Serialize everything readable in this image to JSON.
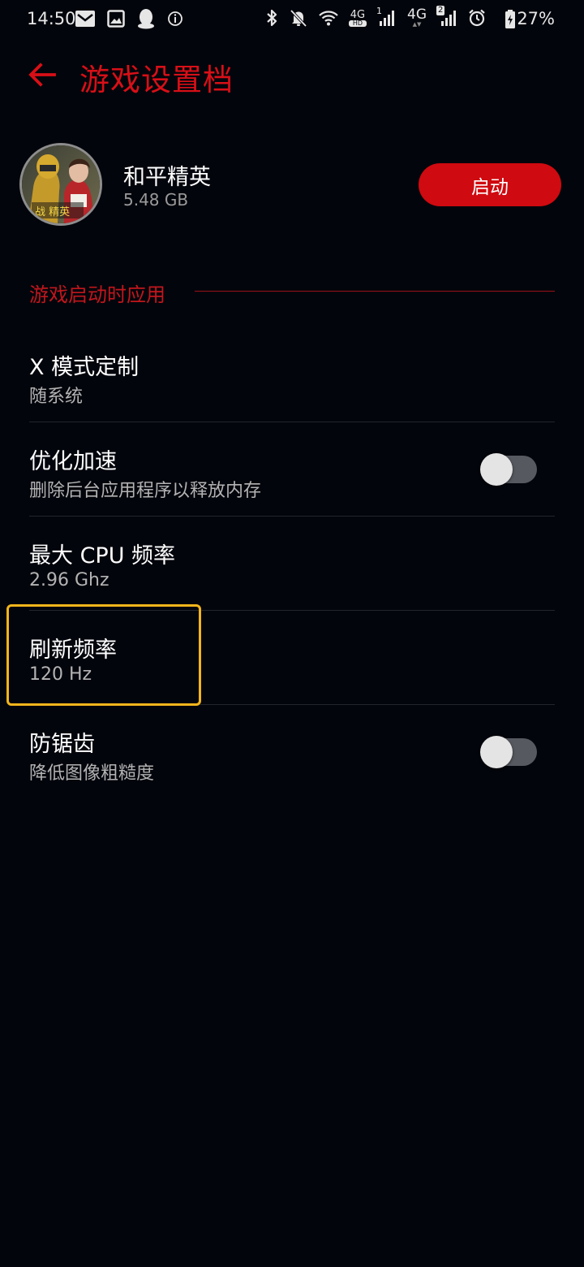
{
  "status_bar": {
    "time": "14:50",
    "net_1": "4G",
    "net_1_sub": "HD",
    "sim1_label": "1",
    "net_2": "4G",
    "sim2_label": "2",
    "battery_percent": "27%"
  },
  "header": {
    "title": "游戏设置档"
  },
  "game": {
    "name": "和平精英",
    "size": "5.48 GB",
    "launch_label": "启动",
    "avatar_text": "战 精英"
  },
  "section": {
    "title": "游戏启动时应用"
  },
  "settings": [
    {
      "title": "X 模式定制",
      "subtitle": "随系统"
    },
    {
      "title": "优化加速",
      "subtitle": "删除后台应用程序以释放内存",
      "toggle_on": false
    },
    {
      "title": "最大 CPU 频率",
      "subtitle": "2.96 Ghz"
    },
    {
      "title": "刷新频率",
      "subtitle": "120 Hz"
    },
    {
      "title": "防锯齿",
      "subtitle": "降低图像粗糙度",
      "toggle_on": false
    }
  ],
  "colors": {
    "accent": "#d80f17",
    "background": "#03050c",
    "highlight": "#f3b51b",
    "toggle_off_track": "#56595f"
  }
}
